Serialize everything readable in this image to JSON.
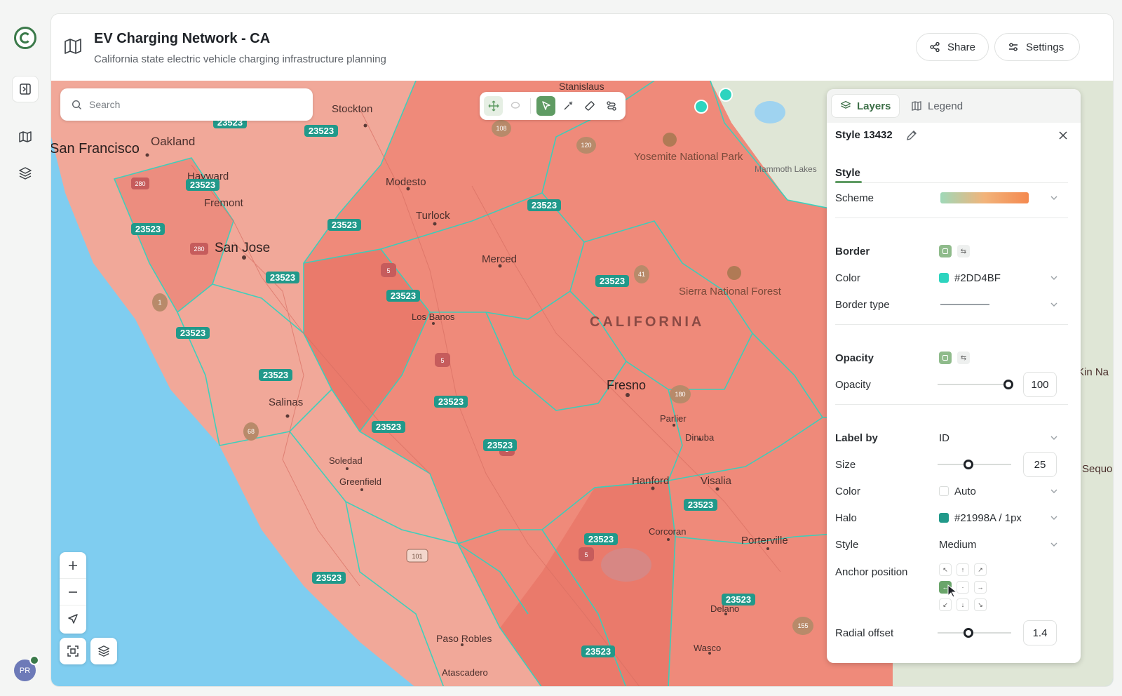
{
  "app": {
    "title": "EV Charging Network - CA",
    "subtitle": "California state electric vehicle charging infrastructure planning",
    "avatar_initials": "PR"
  },
  "header": {
    "share_label": "Share",
    "settings_label": "Settings"
  },
  "search": {
    "placeholder": "Search"
  },
  "map": {
    "region_label_main": "CALIFORNIA",
    "cities": [
      {
        "name": "San Francisco"
      },
      {
        "name": "Oakland"
      },
      {
        "name": "Hayward"
      },
      {
        "name": "Fremont"
      },
      {
        "name": "San Jose"
      },
      {
        "name": "Stockton"
      },
      {
        "name": "Modesto"
      },
      {
        "name": "Turlock"
      },
      {
        "name": "Merced"
      },
      {
        "name": "Los Banos"
      },
      {
        "name": "Salinas"
      },
      {
        "name": "Soledad"
      },
      {
        "name": "Greenfield"
      },
      {
        "name": "Fresno"
      },
      {
        "name": "Parlier"
      },
      {
        "name": "Dinuba"
      },
      {
        "name": "Hanford"
      },
      {
        "name": "Visalia"
      },
      {
        "name": "Corcoran"
      },
      {
        "name": "Porterville"
      },
      {
        "name": "Delano"
      },
      {
        "name": "Wasco"
      },
      {
        "name": "Paso Robles"
      },
      {
        "name": "Atascadero"
      },
      {
        "name": "Stanislaus"
      },
      {
        "name": "Mammoth Lakes"
      },
      {
        "name": "Sequo"
      },
      {
        "name": "Kin Na"
      }
    ],
    "parks": [
      {
        "name": "Yosemite National Park"
      },
      {
        "name": "Sierra National Forest"
      }
    ],
    "highways": [
      "280",
      "280",
      "1",
      "68",
      "5",
      "5",
      "5",
      "5",
      "101",
      "108",
      "120",
      "41",
      "180",
      "155"
    ],
    "feature_label_value": "23523",
    "feature_label_count": 19,
    "fill_color": "#F08E7E",
    "border_color": "#2DD4BF"
  },
  "panel": {
    "tabs": [
      {
        "label": "Layers",
        "active": true,
        "icon": "layers-icon"
      },
      {
        "label": "Legend",
        "active": false,
        "icon": "book-icon"
      }
    ],
    "style_title": "Style 13432",
    "section_tab": "Style",
    "scheme_label": "Scheme",
    "scheme_gradient": [
      "#9fd8b8",
      "#f2b37a",
      "#f4894f"
    ],
    "border": {
      "label": "Border",
      "color_label": "Color",
      "color_value": "#2DD4BF",
      "type_label": "Border type"
    },
    "opacity": {
      "label": "Opacity",
      "slider_label": "Opacity",
      "value": "100",
      "fraction": 1.0
    },
    "label_by": {
      "label": "Label by",
      "value": "ID",
      "size_label": "Size",
      "size_value": "25",
      "size_fraction": 0.42,
      "color_label": "Color",
      "color_value": "Auto",
      "halo_label": "Halo",
      "halo_value": "#21998A / 1px",
      "halo_color": "#21998A",
      "style_label": "Style",
      "style_value": "Medium",
      "anchor_label": "Anchor position",
      "anchor_selected": "left",
      "radial_label": "Radial offset",
      "radial_value": "1.4",
      "radial_fraction": 0.42
    }
  }
}
